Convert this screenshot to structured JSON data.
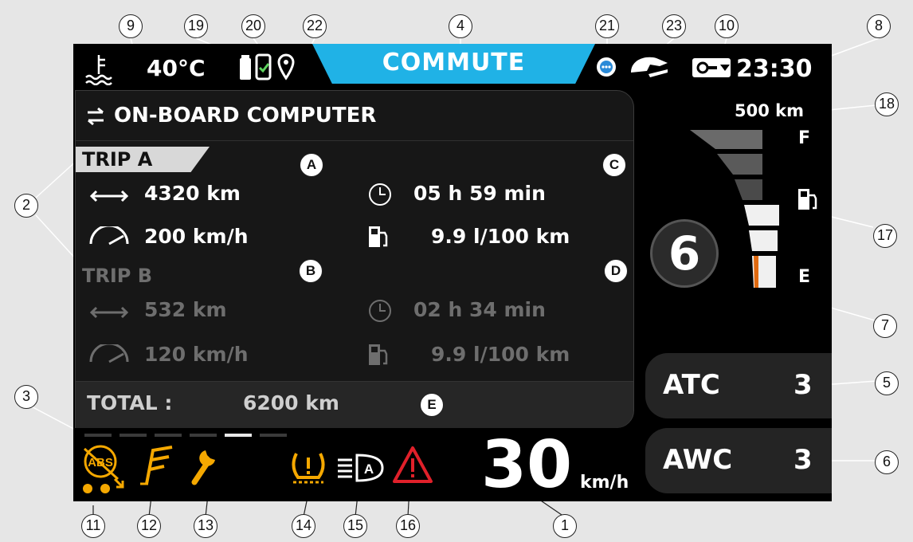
{
  "status_bar": {
    "temperature": "40°C",
    "mode": "COMMUTE",
    "clock": "23:30",
    "range": "500 km"
  },
  "onboard": {
    "title": "ON-BOARD COMPUTER",
    "trip_a": {
      "label": "TRIP A",
      "distance": "4320 km",
      "time": "05 h 59 min",
      "speed": "200 km/h",
      "consumption": "9.9 l/100 km"
    },
    "trip_b": {
      "label": "TRIP B",
      "distance": "532 km",
      "time": "02 h 34 min",
      "speed": "120 km/h",
      "consumption": "9.9 l/100 km"
    },
    "total_label": "TOTAL :",
    "total_value": "6200 km"
  },
  "fuel_gauge": {
    "full_label": "F",
    "empty_label": "E",
    "level_fraction": 0.5
  },
  "gear": "6",
  "atc": {
    "label": "ATC",
    "value": "3"
  },
  "awc": {
    "label": "AWC",
    "value": "3"
  },
  "speed": {
    "value": "30",
    "unit": "km/h"
  },
  "page_dots": {
    "count": 6,
    "active": 5
  },
  "callouts": {
    "n1": "1",
    "n2": "2",
    "n3": "3",
    "n4": "4",
    "n5": "5",
    "n6": "6",
    "n7": "7",
    "n8": "8",
    "n9": "9",
    "n10": "10",
    "n11": "11",
    "n12": "12",
    "n13": "13",
    "n14": "14",
    "n15": "15",
    "n16": "16",
    "n17": "17",
    "n18": "18",
    "n19": "19",
    "n20": "20",
    "n21": "21",
    "n22": "22",
    "n23": "23",
    "A": "A",
    "B": "B",
    "C": "C",
    "D": "D",
    "E": "E"
  },
  "colors": {
    "accent": "#20b2e6",
    "warning_amber": "#f5a800",
    "alert_red": "#e0202a",
    "gauge_orange": "#e06a10"
  },
  "icons": [
    "coolant-temp-icon",
    "battery-icon",
    "phone-icon",
    "location-pin-icon",
    "chat-icon",
    "helmet-icon",
    "key-icon",
    "abs-icon",
    "traction-icon",
    "wrench-icon",
    "tire-pressure-icon",
    "headlight-icon",
    "warning-triangle-icon",
    "fuel-pump-icon",
    "clock-icon",
    "speedometer-icon",
    "distance-icon"
  ]
}
